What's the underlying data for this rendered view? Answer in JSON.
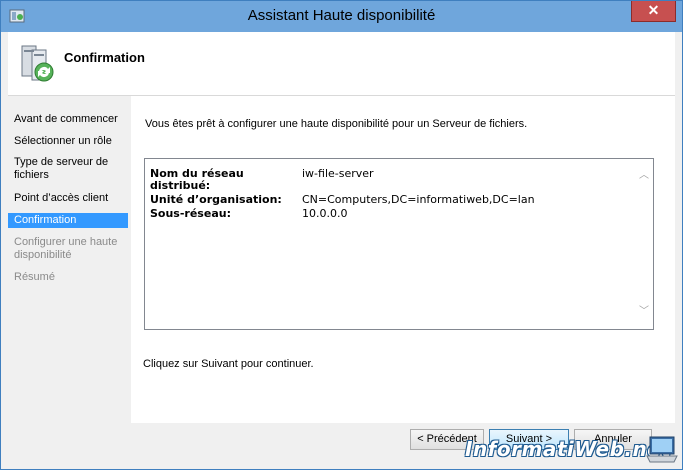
{
  "window": {
    "title": "Assistant Haute disponibilité",
    "close_label": "✕"
  },
  "header": {
    "title": "Confirmation",
    "icon": "cluster-server-icon"
  },
  "sidebar": {
    "items": [
      {
        "label": "Avant de commencer",
        "state": "normal"
      },
      {
        "label": "Sélectionner un rôle",
        "state": "normal"
      },
      {
        "label": "Type de serveur de fichiers",
        "state": "normal"
      },
      {
        "label": "Point d’accès client",
        "state": "normal"
      },
      {
        "label": "Confirmation",
        "state": "selected"
      },
      {
        "label": "Configurer une haute disponibilité",
        "state": "disabled"
      },
      {
        "label": "Résumé",
        "state": "disabled"
      }
    ]
  },
  "content": {
    "intro": "Vous êtes prêt à configurer une haute disponibilité pour un Serveur de fichiers.",
    "details": [
      {
        "key": "Nom du réseau distribué:",
        "value": "iw-file-server"
      },
      {
        "key": "Unité d’organisation:",
        "value": "CN=Computers,DC=informatiweb,DC=lan"
      },
      {
        "key": "Sous-réseau:",
        "value": "10.0.0.0"
      }
    ],
    "outro": "Cliquez sur Suivant pour continuer."
  },
  "buttons": {
    "previous": "< Précédent",
    "next": "Suivant >",
    "cancel": "Annuler"
  },
  "watermark": {
    "text": "InformatiWeb.net"
  },
  "colors": {
    "titlebar": "#6fa6dc",
    "selected": "#3399ff",
    "close": "#c75050"
  }
}
